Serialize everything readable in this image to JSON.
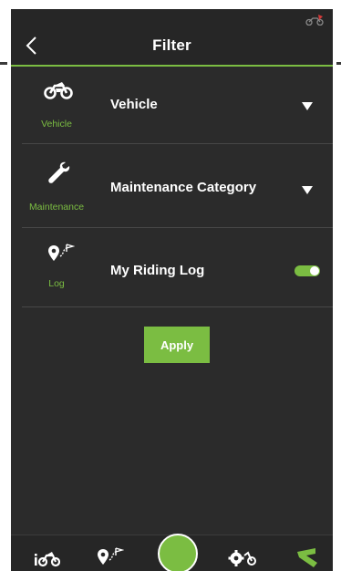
{
  "header": {
    "title": "Filter",
    "back_icon": "chevron-left-icon",
    "corner_icon": "motorcycle-logo-icon"
  },
  "filters": [
    {
      "icon": "motorcycle-icon",
      "icon_label": "Vehicle",
      "label": "Vehicle",
      "control": "dropdown"
    },
    {
      "icon": "wrench-icon",
      "icon_label": "Maintenance",
      "label": "Maintenance Category",
      "control": "dropdown"
    },
    {
      "icon": "route-pin-icon",
      "icon_label": "Log",
      "label": "My Riding Log",
      "control": "toggle",
      "toggle_on": true
    }
  ],
  "apply_label": "Apply",
  "bottom_nav": [
    {
      "icon": "info-motorcycle-icon"
    },
    {
      "icon": "route-pin-icon"
    },
    {
      "icon": "center-action-circle"
    },
    {
      "icon": "settings-motorcycle-icon"
    },
    {
      "icon": "brand-logo-icon"
    }
  ],
  "colors": {
    "accent": "#7bbd42",
    "background": "#2b2b2b",
    "header": "#262626",
    "text": "#ffffff"
  }
}
